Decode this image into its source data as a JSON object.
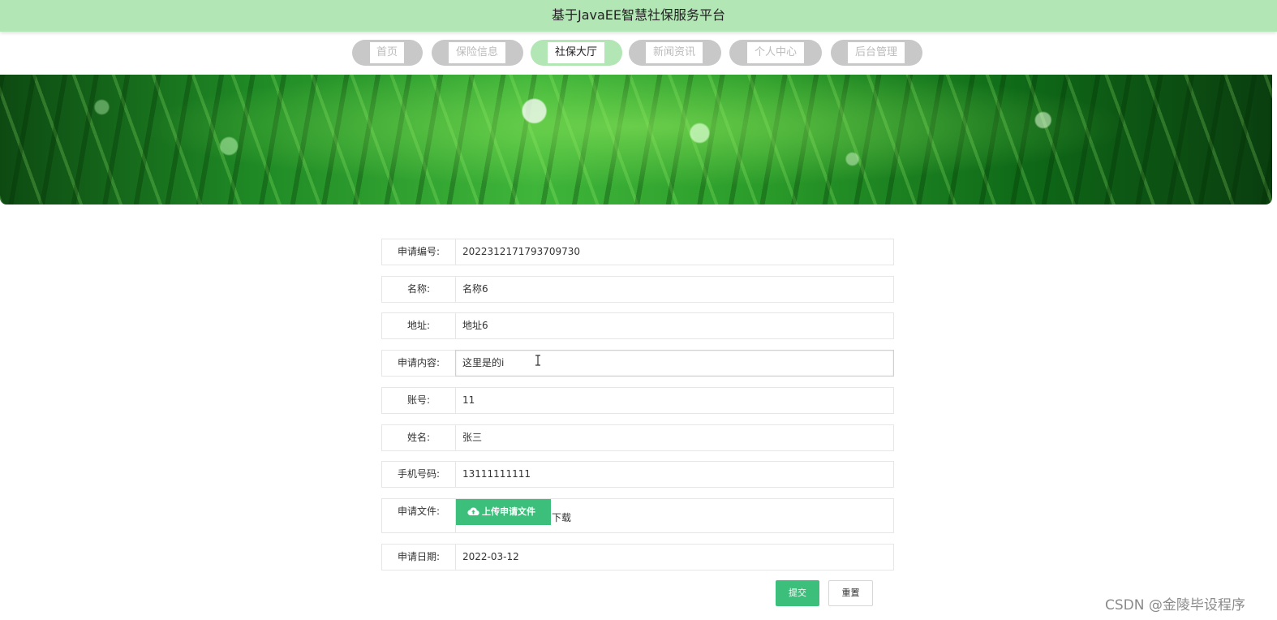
{
  "header": {
    "title": "基于JavaEE智慧社保服务平台"
  },
  "nav": {
    "items": [
      {
        "label": "首页",
        "active": false
      },
      {
        "label": "保险信息",
        "active": false
      },
      {
        "label": "社保大厅",
        "active": true
      },
      {
        "label": "新闻资讯",
        "active": false
      },
      {
        "label": "个人中心",
        "active": false
      },
      {
        "label": "后台管理",
        "active": false
      }
    ]
  },
  "form": {
    "fields": [
      {
        "label": "申请编号:",
        "value": "2022312171793709730"
      },
      {
        "label": "名称:",
        "value": "名称6"
      },
      {
        "label": "地址:",
        "value": "地址6"
      },
      {
        "label": "申请内容:",
        "value": "这里是的i"
      },
      {
        "label": "账号:",
        "value": "11"
      },
      {
        "label": "姓名:",
        "value": "张三"
      },
      {
        "label": "手机号码:",
        "value": "13111111111"
      },
      {
        "label": "申请文件:",
        "upload_label": "上传申请文件",
        "download_label": "下载"
      },
      {
        "label": "申请日期:",
        "value": "2022-03-12"
      }
    ],
    "submit_label": "提交",
    "reset_label": "重置"
  },
  "watermark": "CSDN @金陵毕设程序",
  "colors": {
    "header_bg": "#b3e6b5",
    "nav_active_bg": "#b3e6b5",
    "nav_inactive_bg": "#c8c8c8",
    "primary_button": "#3dbf7c"
  },
  "icons": {
    "upload": "cloud-upload-icon",
    "cursor": "text-cursor-icon"
  }
}
